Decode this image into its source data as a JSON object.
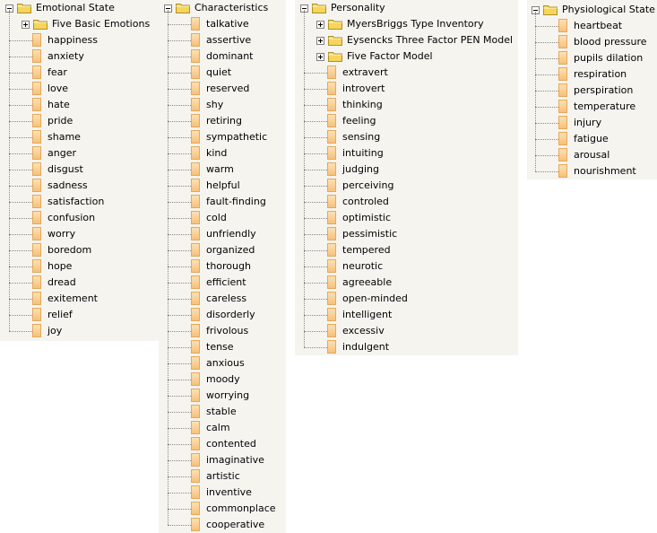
{
  "trees": [
    {
      "root": "Emotional State",
      "groups": [
        "Five Basic Emotions"
      ],
      "leaves": [
        "happiness",
        "anxiety",
        "fear",
        "love",
        "hate",
        "pride",
        "shame",
        "anger",
        "disgust",
        "sadness",
        "satisfaction",
        "confusion",
        "worry",
        "boredom",
        "hope",
        "dread",
        "exitement",
        "relief",
        "joy"
      ]
    },
    {
      "root": "Characteristics",
      "groups": [],
      "leaves": [
        "talkative",
        "assertive",
        "dominant",
        "quiet",
        "reserved",
        "shy",
        "retiring",
        "sympathetic",
        "kind",
        "warm",
        "helpful",
        "fault-finding",
        "cold",
        "unfriendly",
        "organized",
        "thorough",
        "efficient",
        "careless",
        "disorderly",
        "frivolous",
        "tense",
        "anxious",
        "moody",
        "worrying",
        "stable",
        "calm",
        "contented",
        "imaginative",
        "artistic",
        "inventive",
        "commonplace",
        "cooperative"
      ]
    },
    {
      "root": "Personality",
      "groups": [
        "MyersBriggs Type Inventory",
        "Eysencks Three Factor PEN Model",
        "Five Factor Model"
      ],
      "leaves": [
        "extravert",
        "introvert",
        "thinking",
        "feeling",
        "sensing",
        "intuiting",
        "judging",
        "perceiving",
        "controled",
        "optimistic",
        "pessimistic",
        "tempered",
        "neurotic",
        "agreeable",
        "open-minded",
        "intelligent",
        "excessiv",
        "indulgent"
      ]
    },
    {
      "root": "Physiological State",
      "groups": [],
      "leaves": [
        "heartbeat",
        "blood pressure",
        "pupils dilation",
        "respiration",
        "perspiration",
        "temperature",
        "injury",
        "fatigue",
        "arousal",
        "nourishment"
      ]
    }
  ],
  "icons": {
    "expanded": "minus-toggle-icon",
    "collapsed": "plus-toggle-icon",
    "folder": "folder-icon",
    "leaf": "leaf-node-icon"
  },
  "colors": {
    "panel_bg": "#f5f4ef",
    "leaf_fill": "#f7c07a",
    "folder_fill": "#f5d55a",
    "connector": "#8a8a8a"
  }
}
